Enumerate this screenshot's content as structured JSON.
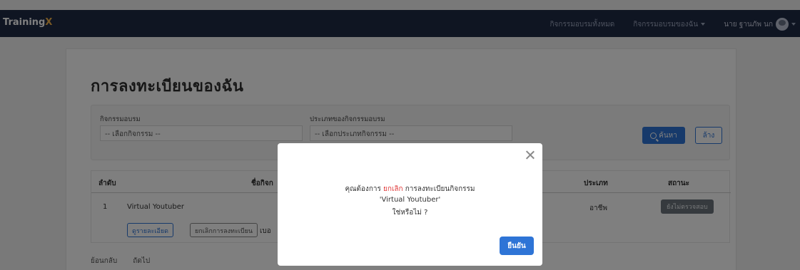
{
  "navbar": {
    "brand_main": "Training",
    "brand_accent": "X",
    "links": [
      "กิจกรรมอบรมทั้งหมด",
      "กิจกรรมอบรมของฉัน"
    ],
    "user_name": "นาย ฐานภัพ นก"
  },
  "page": {
    "title": "การลงทะเบียนของฉัน",
    "filters": {
      "activity_label": "กิจกรรมอบรม",
      "activity_value": "-- เลือกกิจกรรม --",
      "type_label": "ประเภทของกิจกรรมอบรม",
      "type_value": "-- เลือกประเภทกิจกรรม --",
      "search_label": "ค้นหา",
      "clear_label": "ล้าง"
    },
    "table": {
      "headers": {
        "order": "ลำดับ",
        "name": "ชื่อกิจก",
        "type": "ประเภท",
        "status": "สถานะ"
      },
      "rows": [
        {
          "order": "1",
          "name": "Virtual Youtuber",
          "type": "อาชีพ",
          "status": "ยังไม่ตรวจสอบ",
          "detail_label": "ดูรายละเอียด",
          "cancel_label": "ยกเลิกการลงทะเบียน",
          "extra_label": "เบอ"
        }
      ]
    },
    "pager": {
      "prev": "ย้อนกลับ",
      "next": "ถัดไป"
    }
  },
  "modal": {
    "line1_prefix": "คุณต้องการ ",
    "line1_highlight": "ยกเลิก",
    "line1_suffix": " การลงทะเบียนกิจกรรม",
    "line2": "'Virtual Youtuber'",
    "line3": "ใช่หรือไม่ ?",
    "confirm_label": "ยืนยัน"
  },
  "colors": {
    "navbar_bg": "#1f2a44",
    "brand_accent": "#f3b24a",
    "primary": "#2e74d6",
    "danger": "#e03a3a",
    "badge_bg": "#6c757d"
  }
}
